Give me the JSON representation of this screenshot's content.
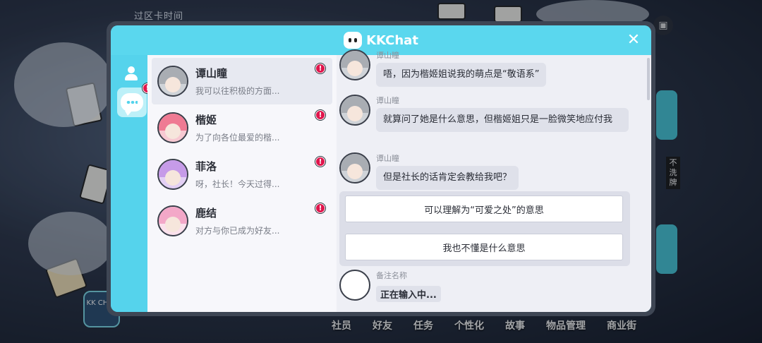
{
  "background": {
    "top_label": "过区卡时间",
    "side_tag": "不洗牌",
    "kk_badge": "KK CHAT",
    "bottom_nav": [
      "社员",
      "好友",
      "任务",
      "个性化",
      "故事",
      "物品管理",
      "商业街"
    ]
  },
  "dialog": {
    "app_title": "KKChat",
    "close_label": "✕"
  },
  "rail": {
    "friends_icon": "person-icon",
    "chat_icon": "chat-bubble-icon",
    "alert_glyph": "!"
  },
  "contacts": [
    {
      "name": "谭山瞳",
      "preview": "我可以往积极的方面...",
      "alert": "!"
    },
    {
      "name": "楷姬",
      "preview": "为了向各位最爱的楷...",
      "alert": "!"
    },
    {
      "name": "菲洛",
      "preview": "呀，社长！今天过得...",
      "alert": "!"
    },
    {
      "name": "鹿结",
      "preview": "对方与你已成为好友...",
      "alert": "!"
    }
  ],
  "chat": {
    "messages": [
      {
        "sender": "谭山瞳",
        "text": "唔，因为楷姬姐说我的萌点是“敬语系”"
      },
      {
        "sender": "谭山瞳",
        "text": "就算问了她是什么意思，但楷姬姐只是一脸微笑地应付我"
      },
      {
        "sender": "谭山瞳",
        "text": "但是社长的话肯定会教给我吧？"
      }
    ],
    "options": [
      "可以理解为“可爱之处”的意思",
      "我也不懂是什么意思"
    ],
    "self_label": "备注名称",
    "typing": "正在输入中..."
  },
  "colors": {
    "accent": "#55d3ec",
    "alert": "#e0154c"
  }
}
